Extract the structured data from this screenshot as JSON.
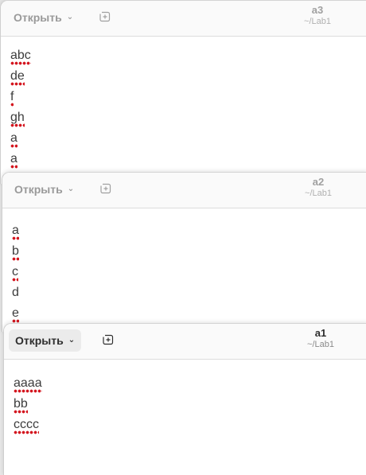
{
  "windows": [
    {
      "id": "a3",
      "open_label": "Открыть",
      "title": "a3",
      "subtitle": "~/Lab1",
      "lines": [
        "abc",
        "de",
        "f",
        "gh",
        "a",
        "a"
      ]
    },
    {
      "id": "a2",
      "open_label": "Открыть",
      "title": "a2",
      "subtitle": "~/Lab1",
      "lines": [
        "a",
        "b",
        "c",
        "d",
        "e"
      ]
    },
    {
      "id": "a1",
      "open_label": "Открыть",
      "title": "a1",
      "subtitle": "~/Lab1",
      "lines": [
        "aaaa",
        "bb",
        "cccc"
      ]
    }
  ],
  "icons": {
    "open_dropdown": "chevron-down-icon",
    "new_tab": "new-tab-icon"
  },
  "colors": {
    "spellcheck_underline": "#d4161f",
    "window_bg": "#ffffff",
    "header_bg": "#fafafa"
  }
}
